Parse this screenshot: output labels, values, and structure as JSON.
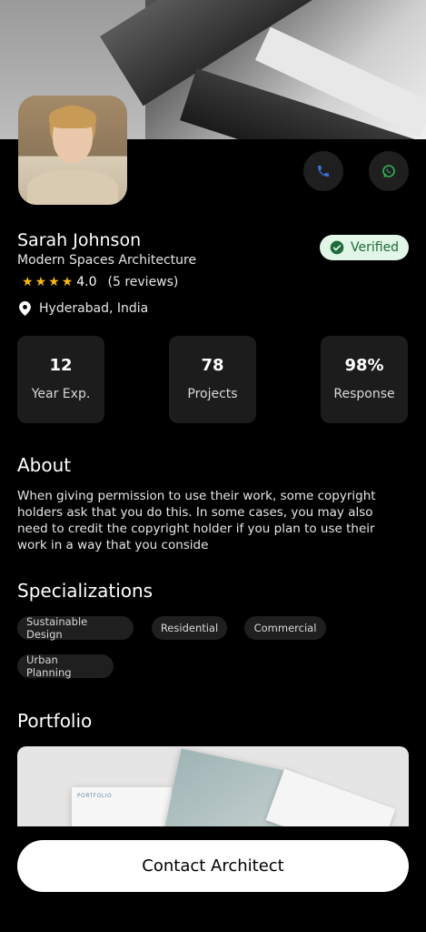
{
  "profile": {
    "name": "Sarah Johnson",
    "firm": "Modern Spaces Architecture",
    "verified_label": "Verified",
    "rating_score": "4.0",
    "rating_reviews": "(5 reviews)",
    "stars_filled": 4,
    "location": "Hyderabad, India"
  },
  "stats": [
    {
      "value": "12",
      "label": "Year Exp."
    },
    {
      "value": "78",
      "label": "Projects"
    },
    {
      "value": "98%",
      "label": "Response"
    }
  ],
  "about": {
    "title": "About",
    "text": "When giving permission to use their work, some copyright holders ask that you do this. In some cases, you may also need to credit the copyright holder if you plan to use their work in a way that you conside"
  },
  "specializations": {
    "title": "Specializations",
    "chips": [
      "Sustainable Design",
      "Residential",
      "Commercial",
      "Urban Planning"
    ]
  },
  "portfolio": {
    "title": "Portfolio",
    "image_label": "PORTFOLIO"
  },
  "cta": {
    "contact_label": "Contact Architect"
  },
  "icons": {
    "call": "phone-icon",
    "whatsapp": "whatsapp-icon",
    "verified": "check-circle-icon",
    "location": "location-pin-icon",
    "star": "star-icon"
  },
  "colors": {
    "background": "#000000",
    "card": "#1c1c1c",
    "verified_bg": "#e1f6e6",
    "verified_text": "#1f6b3a",
    "star": "#f5b71b",
    "phone_icon": "#3b6fd8",
    "whatsapp_icon": "#2fb05a"
  }
}
